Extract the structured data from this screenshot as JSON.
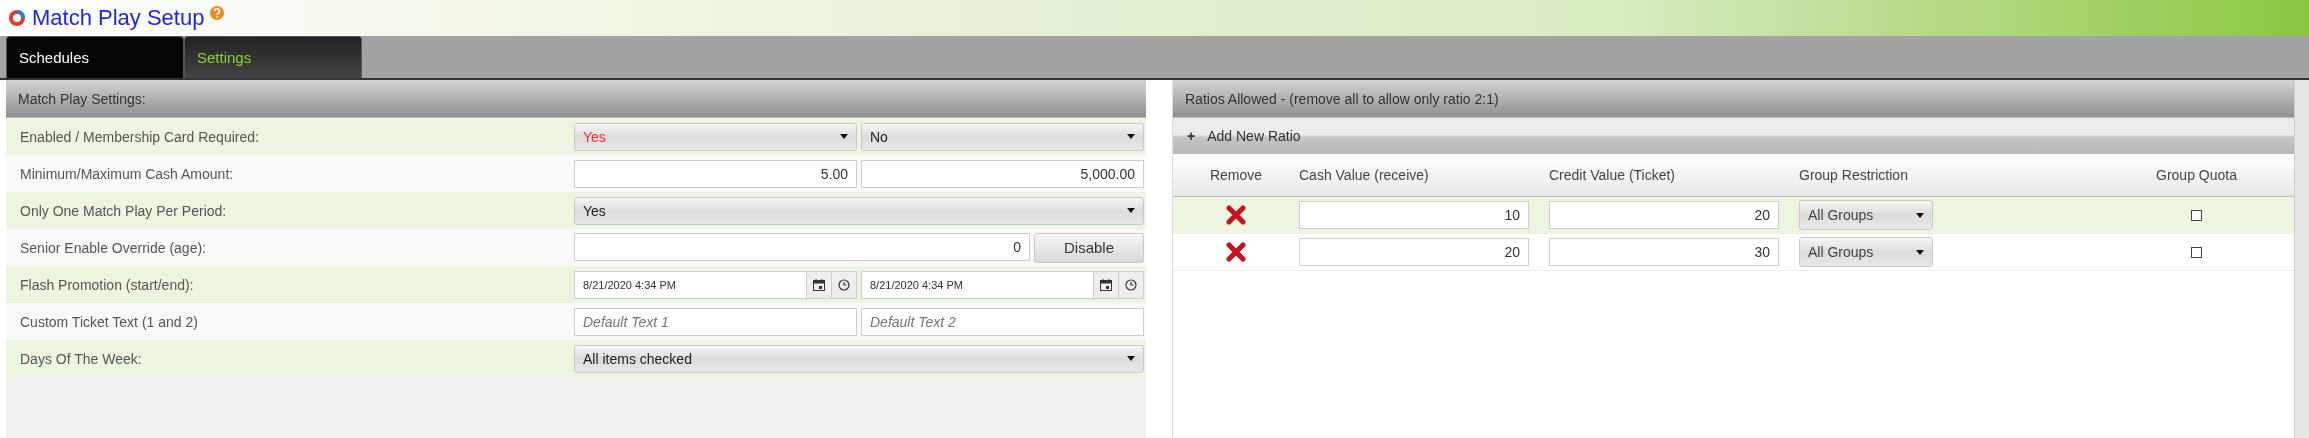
{
  "title": "Match Play Setup",
  "tabs": [
    {
      "label": "Schedules",
      "selected": false
    },
    {
      "label": "Settings",
      "selected": true
    }
  ],
  "settings": {
    "title": "Match Play Settings:",
    "rows": [
      {
        "kind": "select_pair",
        "label": "Enabled / Membership Card Required:",
        "fields": [
          {
            "value": "Yes",
            "color": "#ff2a2a"
          },
          {
            "value": "No",
            "color": "#222222"
          }
        ]
      },
      {
        "kind": "input_pair",
        "label": "Minimum/Maximum Cash Amount:",
        "fields": [
          {
            "value": "5.00"
          },
          {
            "value": "5,000.00"
          }
        ]
      },
      {
        "kind": "select",
        "label": "Only One Match Play Per Period:",
        "fields": [
          {
            "value": "Yes",
            "color": "#222222"
          }
        ]
      },
      {
        "kind": "input_button",
        "label": "Senior Enable Override (age):",
        "fields": [
          {
            "value": "0"
          }
        ],
        "button": "Disable"
      },
      {
        "kind": "datetime_pair",
        "label": "Flash Promotion (start/end):",
        "fields": [
          {
            "value": "8/21/2020 4:34 PM"
          },
          {
            "value": "8/21/2020 4:34 PM"
          }
        ]
      },
      {
        "kind": "text_pair",
        "label": "Custom Ticket Text (1 and 2)",
        "fields": [
          {
            "placeholder": "Default Text 1"
          },
          {
            "placeholder": "Default Text 2"
          }
        ]
      },
      {
        "kind": "select",
        "label": "Days Of The Week:",
        "fields": [
          {
            "value": "All items checked",
            "color": "#222222"
          }
        ]
      }
    ]
  },
  "ratios": {
    "title": "Ratios Allowed - (remove all to allow only ratio 2:1)",
    "add_button": "Add New Ratio",
    "add_icon": "+",
    "columns": [
      "Remove",
      "Cash Value (receive)",
      "Credit Value (Ticket)",
      "Group Restriction",
      "Group Quota"
    ],
    "rows": [
      {
        "cash": "10",
        "credit": "20",
        "group": "All Groups",
        "quota": false
      },
      {
        "cash": "20",
        "credit": "30",
        "group": "All Groups",
        "quota": false
      }
    ]
  }
}
